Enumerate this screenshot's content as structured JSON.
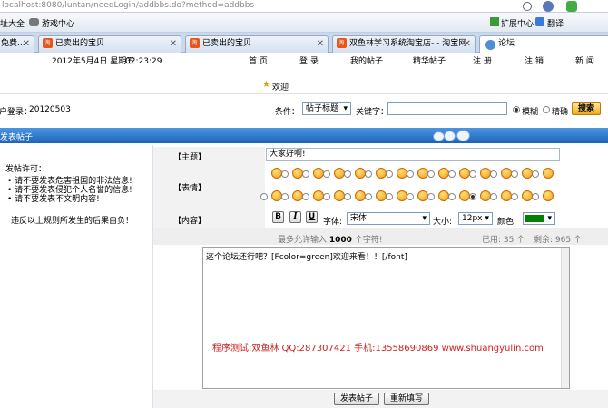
{
  "browser": {
    "address": "localhost:8080/luntan/needLogin/addbbs.do?method=addbbs",
    "fav_left_1": "址大全",
    "fav_left_2": "游戏中心",
    "fav_ext": "扩展中心",
    "fav_translate": "翻译"
  },
  "tabs": [
    {
      "label": "免费..."
    },
    {
      "label": "已卖出的宝贝"
    },
    {
      "label": "已卖出的宝贝"
    },
    {
      "label": "双鱼林学习系统淘宝店- - 淘宝网"
    },
    {
      "label": "论坛"
    }
  ],
  "nav": {
    "date": "2012年5月4日  星期五",
    "time": "02:23:29",
    "home": "首 页",
    "login": "登 录",
    "my_posts": "我的帖子",
    "elite": "精华帖子",
    "register": "注 册",
    "logout": "注 销",
    "news": "新 闻",
    "welcome": "欢迎"
  },
  "search": {
    "user_label": "用户登录：",
    "user_value": "20120503",
    "condition_label": "条件：",
    "condition_value": "帖子标题",
    "keyword_label": "关键字：",
    "keyword_value": "",
    "fuzzy": "模糊",
    "exact": "精确",
    "search_btn": "搜索"
  },
  "section": {
    "title": "发表帖子"
  },
  "left": {
    "heading": "发帖许可：",
    "rules": [
      "请不要发表危害祖国的非法信息!",
      "请不要发表侵犯个人名誉的信息!",
      "请不要发表不文明内容!"
    ],
    "footer": "违反以上规则所发生的后果自负！"
  },
  "form": {
    "subject_label": "【主题】",
    "subject_value": "大家好啊!",
    "emotion_label": "【表情】",
    "content_label": "【内容】",
    "bold": "B",
    "italic": "I",
    "underline": "U",
    "font_label": "字体:",
    "font_value": "宋体",
    "size_label": "大小:",
    "size_value": "12px",
    "color_label": "颜色:",
    "color_value": "#008000",
    "limit_text": "最多允许输入",
    "limit_num": "1000",
    "limit_suffix": "个字符!",
    "used_label": "已用:",
    "used_num": "35",
    "used_unit": "个",
    "remain_label": "剩余:",
    "remain_num": "965",
    "remain_unit": "个",
    "content_value": "这个论坛还行吧？[Fcolor=green]欢迎来看！！[/font]",
    "watermark": "程序测试:双鱼林 QQ:287307421 手机:13558690869 www.shuangyulin.com",
    "submit": "发表帖子",
    "reset": "重新填写"
  },
  "colors": {
    "header_bar": "#1f6fc6",
    "watermark": "#d22020",
    "select_color": "#008000"
  }
}
